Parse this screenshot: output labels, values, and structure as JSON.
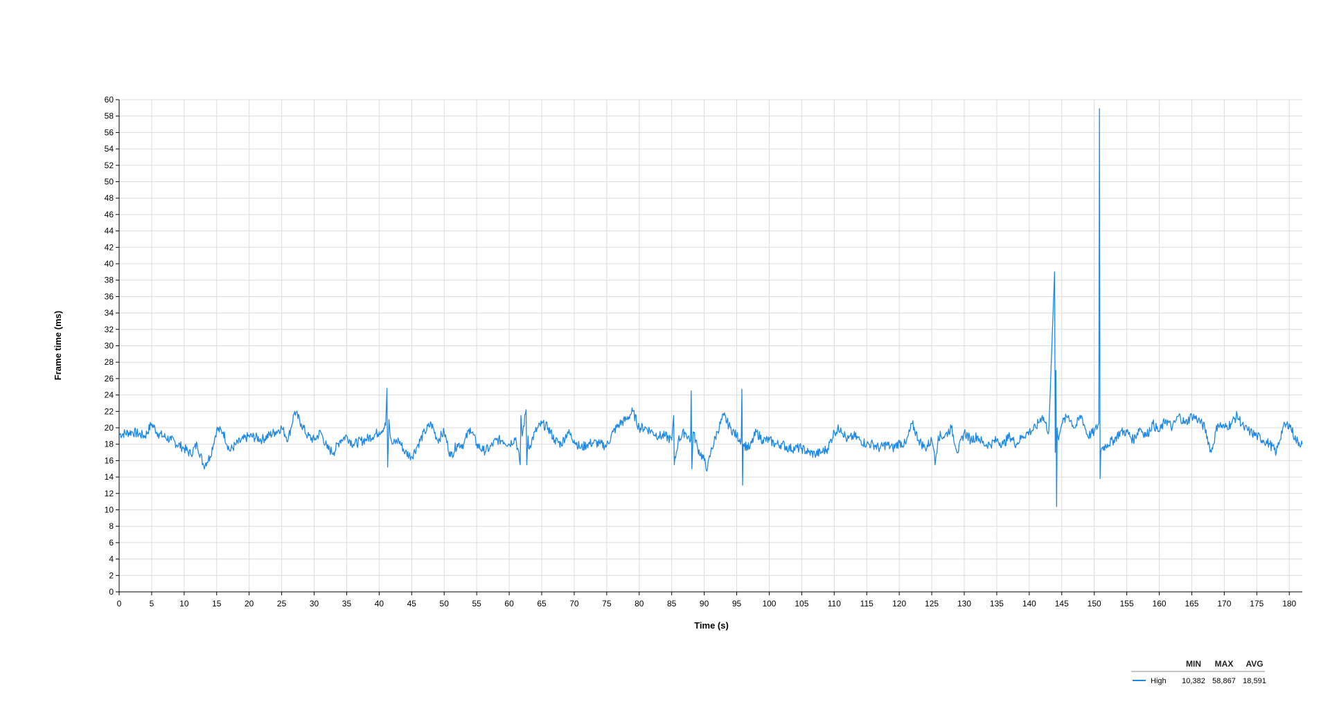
{
  "chart_data": {
    "type": "line",
    "xlabel": "Time (s)",
    "ylabel": "Frame time (ms)",
    "xlim": [
      0,
      182
    ],
    "ylim": [
      0,
      60
    ],
    "x_ticks": [
      0,
      5,
      10,
      15,
      20,
      25,
      30,
      35,
      40,
      45,
      50,
      55,
      60,
      65,
      70,
      75,
      80,
      85,
      90,
      95,
      100,
      105,
      110,
      115,
      120,
      125,
      130,
      135,
      140,
      145,
      150,
      155,
      160,
      165,
      170,
      175,
      180
    ],
    "y_ticks": [
      0,
      2,
      4,
      6,
      8,
      10,
      12,
      14,
      16,
      18,
      20,
      22,
      24,
      26,
      28,
      30,
      32,
      34,
      36,
      38,
      40,
      42,
      44,
      46,
      48,
      50,
      52,
      54,
      56,
      58,
      60
    ],
    "grid": true,
    "legend_position": "bottom-right",
    "series": [
      {
        "name": "High",
        "color": "#1e88e5",
        "x": [
          0,
          2,
          4,
          5,
          6,
          8,
          10,
          11,
          12,
          13,
          14,
          15,
          16,
          17,
          18,
          20,
          22,
          24,
          25,
          26,
          27,
          28,
          29,
          30,
          31,
          32,
          33,
          34,
          35,
          36,
          38,
          40,
          41,
          41.2,
          41.3,
          41.5,
          41.7,
          42,
          43,
          44,
          45,
          46,
          47,
          48,
          49,
          50,
          51,
          52,
          53,
          54,
          55,
          56,
          57,
          58,
          59,
          60,
          61,
          61.7,
          61.8,
          62,
          62.6,
          62.7,
          62.9,
          63,
          64,
          65,
          66,
          67,
          68,
          69,
          70,
          71,
          72,
          73,
          74,
          75,
          76,
          77,
          78,
          79,
          80,
          81,
          82,
          83,
          84,
          85,
          85.3,
          85.4,
          86,
          87,
          87.9,
          88,
          88.1,
          88.3,
          89,
          90,
          90.5,
          91,
          92,
          93,
          94,
          95,
          95.7,
          95.8,
          95.9,
          96,
          97,
          98,
          99,
          100,
          101,
          102,
          103,
          104,
          105,
          106,
          107,
          108,
          109,
          110,
          111,
          112,
          113,
          114,
          115,
          116,
          117,
          118,
          119,
          120,
          121,
          122,
          123,
          124,
          125,
          125.4,
          125.5,
          126,
          127,
          128,
          129,
          130,
          131,
          132,
          133,
          134,
          135,
          136,
          137,
          138,
          139,
          140,
          141,
          142,
          143,
          143.9,
          144.0,
          144.1,
          144.2,
          144.3,
          144.4,
          144.5,
          144.6,
          145,
          146,
          147,
          148,
          149,
          150,
          150.7,
          150.8,
          150.9,
          151.0,
          151.1,
          151.2,
          152,
          153,
          154,
          155,
          156,
          157,
          158,
          159,
          160,
          161,
          162,
          163,
          164,
          165,
          166,
          167,
          168,
          169,
          170,
          171,
          172,
          173,
          174,
          175,
          176,
          177,
          178,
          179,
          180,
          181,
          182
        ],
        "values": [
          19.2,
          19.5,
          19.0,
          20.5,
          19.3,
          18.5,
          17.5,
          16.8,
          18.0,
          15.4,
          16.5,
          19.8,
          19.5,
          17.2,
          18.0,
          19.0,
          18.6,
          19.5,
          20.0,
          18.6,
          22.0,
          20.5,
          19.0,
          18.5,
          19.5,
          17.5,
          17.0,
          18.5,
          19.0,
          18.0,
          18.6,
          19.5,
          20.3,
          24.8,
          15.2,
          21.0,
          19.0,
          18.0,
          18.5,
          17.0,
          16.5,
          18.0,
          19.5,
          20.5,
          18.5,
          19.5,
          16.5,
          18.0,
          18.0,
          20.0,
          18.0,
          17.2,
          17.5,
          18.5,
          18.5,
          18.0,
          18.8,
          15.5,
          21.5,
          19.0,
          22.2,
          15.5,
          19.0,
          17.5,
          19.5,
          20.5,
          20.0,
          18.5,
          18.0,
          19.5,
          18.5,
          17.5,
          18.0,
          18.2,
          18.0,
          17.8,
          19.5,
          20.5,
          21.0,
          22.0,
          20.0,
          20.0,
          19.5,
          19.0,
          19.0,
          18.5,
          21.5,
          15.5,
          18.5,
          19.5,
          18.5,
          24.5,
          15.0,
          19.5,
          17.5,
          16.0,
          15.0,
          17.0,
          19.5,
          21.5,
          20.0,
          19.0,
          18.5,
          24.7,
          13.0,
          18.0,
          17.5,
          19.5,
          18.5,
          18.5,
          18.0,
          18.0,
          17.5,
          17.5,
          17.5,
          17.0,
          16.8,
          17.0,
          17.5,
          19.5,
          20.0,
          18.5,
          19.0,
          18.5,
          18.0,
          18.0,
          17.5,
          18.0,
          17.5,
          18.2,
          18.0,
          20.5,
          18.5,
          17.5,
          18.5,
          17.0,
          15.5,
          19.0,
          19.0,
          20.0,
          17.0,
          19.5,
          18.5,
          19.0,
          18.0,
          18.0,
          18.5,
          18.0,
          19.0,
          18.0,
          19.0,
          19.5,
          20.0,
          21.5,
          19.5,
          39.0,
          17.0,
          27.0,
          10.4,
          20.0,
          19.0,
          18.5,
          19.0,
          20.5,
          21.5,
          20.0,
          21.5,
          19.0,
          19.5,
          20.5,
          58.9,
          13.8,
          17.0,
          17.5,
          17.5,
          18.0,
          18.5,
          19.5,
          19.5,
          18.5,
          20.0,
          19.0,
          20.5,
          19.5,
          21.0,
          20.0,
          21.5,
          20.5,
          21.5,
          21.0,
          20.0,
          17.0,
          20.5,
          20.0,
          20.5,
          21.5,
          20.0,
          19.5,
          19.0,
          18.5,
          18.0,
          17.0,
          20.0,
          20.5,
          18.5,
          18.0
        ]
      }
    ],
    "stats": {
      "headers": [
        "MIN",
        "MAX",
        "AVG"
      ],
      "rows": [
        {
          "name": "High",
          "min": "10,382",
          "max": "58,867",
          "avg": "18,591"
        }
      ]
    }
  }
}
